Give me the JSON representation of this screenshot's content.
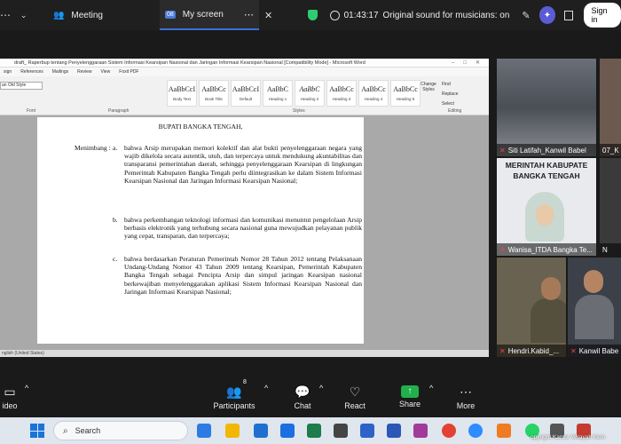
{
  "topbar": {
    "tab_meeting": "Meeting",
    "tab_screen_badge": "08",
    "tab_screen": "My screen",
    "timer": "01:43:17",
    "sound": "Original sound for musicians: on",
    "signin": "Sign in",
    "shield_color": "#2ecc71"
  },
  "word": {
    "title": "draft_ Raperbup tentang Penyelenggaraan Sistem Informasi Kearsipan Nasional dan Jaringan Informasi Kearsipan Nasional [Compatibility Mode] - Microsoft Word",
    "menus": [
      "sign",
      "References",
      "Mailings",
      "Review",
      "View",
      "Foxit PDF"
    ],
    "font_name": "an Old Style",
    "styles": [
      {
        "sample": "AaBbCcI",
        "name": "Body Text"
      },
      {
        "sample": "AaBbCc",
        "name": "Book Title"
      },
      {
        "sample": "AaBbCcI",
        "name": "Default"
      },
      {
        "sample": "AaBbC",
        "name": "Heading 1"
      },
      {
        "sample": "AaBbC",
        "name": "Heading 2"
      },
      {
        "sample": "AaBbCc",
        "name": "Heading 3"
      },
      {
        "sample": "AaBbCc",
        "name": "Heading 4"
      },
      {
        "sample": "AaBbCc",
        "name": "Heading 5"
      }
    ],
    "groups": {
      "font": "Font",
      "paragraph": "Paragraph",
      "styles": "Styles",
      "editing": "Editing"
    },
    "change_styles": "Change Styles",
    "find": "Find",
    "replace": "Replace",
    "select": "Select",
    "language": "nglish (United States)"
  },
  "document": {
    "heading": "BUPATI BANGKA TENGAH,",
    "menimbang": "Menimbang :",
    "clauses": [
      {
        "label": "a.",
        "text": "bahwa Arsip merupakan memori kolektif dan alat bukti penyelenggaraan negara yang wajib dikelola secara autentik, utuh, dan terpercaya untuk mendukung akuntabilitas dan transparansi pemerintahan daerah, sehingga penyelenggaraan Kearsipan di lingkungan Pemerintah Kabupaten Bangka Tengah perlu diintegrasikan ke dalam Sistem Informasi Kearsipan Nasional dan Jaringan Informasi Kearsipan Nasional;"
      },
      {
        "label": "b.",
        "text": "bahwa perkembangan teknologi informasi dan komunikasi menuntut pengelolaan Arsip berbasis elektronik yang terhubung secara nasional guna mewujudkan pelayanan publik yang cepat, transparan, dan terpercaya;"
      },
      {
        "label": "c.",
        "text": "bahwa berdasarkan Peraturan Pemerintah Nomor 28 Tahun 2012 tentang Pelaksanaan Undang-Undang Nomor 43 Tahun 2009 tentang Kearsipan, Pemerintah Kabupaten Bangka Tengah sebagai Pencipta Arsip dan simpul jaringan Kearsipan nasional berkewajiban menyelenggarakan aplikasi Sistem Informasi Kearsipan Nasional dan Jaringan Informasi Kearsipan Nasional;"
      }
    ]
  },
  "participants": [
    {
      "name": "Siti Latifah_Kanwil Babel"
    },
    {
      "name": "07_K"
    },
    {
      "name": "Wanisa_ITDA Bangka Te..."
    },
    {
      "name": "N"
    },
    {
      "name": "Hendri.Kabid_..."
    },
    {
      "name": "Kanwil Babe"
    }
  ],
  "tile_banner": "MERINTAH KABUPATE\nBANGKA TENGAH",
  "controls": {
    "video": "ideo",
    "participants": "Participants",
    "participants_count": "8",
    "chat": "Chat",
    "react": "React",
    "share": "Share",
    "more": "More"
  },
  "taskbar": {
    "search": "Search",
    "credit": "opyright Kantor Wilayah Kem"
  }
}
